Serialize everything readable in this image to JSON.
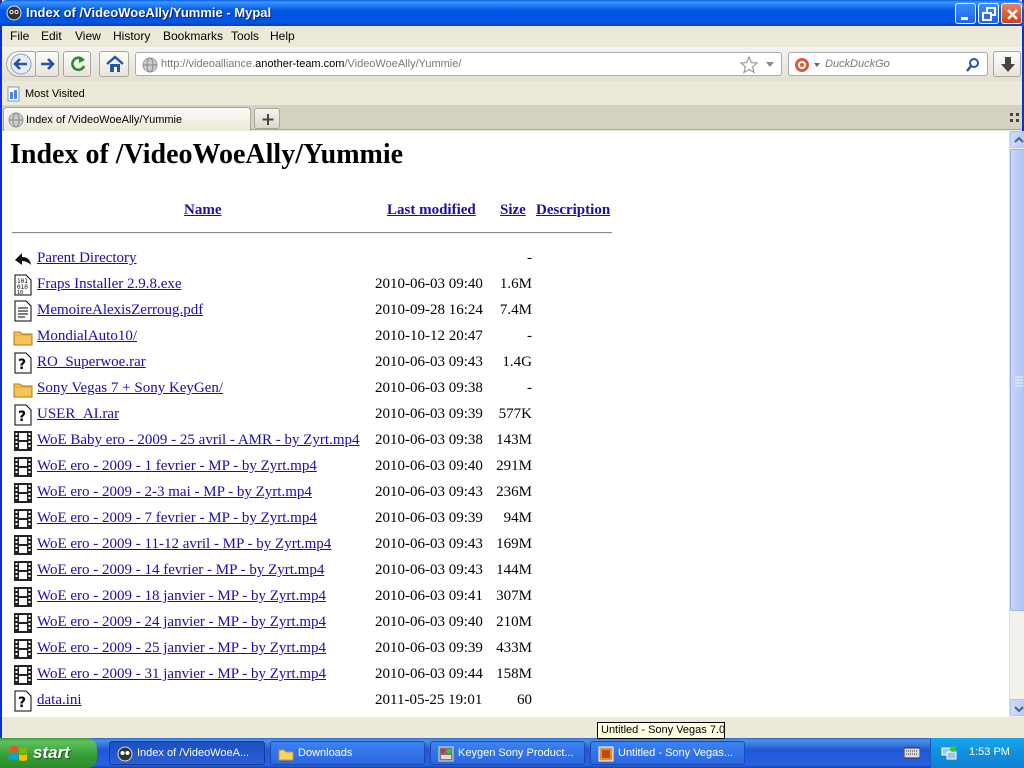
{
  "window": {
    "title": "Index of /VideoWoeAlly/Yummie - Mypal"
  },
  "menu": [
    "File",
    "Edit",
    "View",
    "History",
    "Bookmarks",
    "Tools",
    "Help"
  ],
  "nav": {
    "url_prefix": "http://videoalliance.",
    "url_domain": "another-team.com",
    "url_path": "/VideoWoeAlly/Yummie/",
    "search_placeholder": "DuckDuckGo"
  },
  "bookmarks": {
    "most_visited": "Most Visited"
  },
  "tabs": [
    {
      "label": "Index of /VideoWoeAlly/Yummie"
    }
  ],
  "page": {
    "heading": "Index of /VideoWoeAlly/Yummie",
    "columns": {
      "name": "Name",
      "modified": "Last modified",
      "size": "Size",
      "description": "Description"
    },
    "entries": [
      {
        "icon": "back-icon",
        "name": "Parent Directory",
        "modified": "",
        "size": "-"
      },
      {
        "icon": "binary-icon",
        "name": "Fraps Installer 2.9.8.exe",
        "modified": "2010-06-03 09:40",
        "size": "1.6M"
      },
      {
        "icon": "document-icon",
        "name": "MemoireAlexisZerroug.pdf",
        "modified": "2010-09-28 16:24",
        "size": "7.4M"
      },
      {
        "icon": "folder-icon",
        "name": "MondialAuto10/",
        "modified": "2010-10-12 20:47",
        "size": "-"
      },
      {
        "icon": "unknown-icon",
        "name": "RO_Superwoe.rar",
        "modified": "2010-06-03 09:43",
        "size": "1.4G"
      },
      {
        "icon": "folder-icon",
        "name": "Sony Vegas 7 + Sony KeyGen/",
        "modified": "2010-06-03 09:38",
        "size": "-"
      },
      {
        "icon": "unknown-icon",
        "name": "USER_AI.rar",
        "modified": "2010-06-03 09:39",
        "size": "577K"
      },
      {
        "icon": "movie-icon",
        "name": "WoE Baby ero - 2009 - 25 avril - AMR - by Zyrt.mp4",
        "modified": "2010-06-03 09:38",
        "size": "143M"
      },
      {
        "icon": "movie-icon",
        "name": "WoE ero - 2009 - 1 fevrier - MP - by Zyrt.mp4",
        "modified": "2010-06-03 09:40",
        "size": "291M"
      },
      {
        "icon": "movie-icon",
        "name": "WoE ero - 2009 - 2-3 mai - MP - by Zyrt.mp4",
        "modified": "2010-06-03 09:43",
        "size": "236M"
      },
      {
        "icon": "movie-icon",
        "name": "WoE ero - 2009 - 7 fevrier - MP - by Zyrt.mp4",
        "modified": "2010-06-03 09:39",
        "size": "94M"
      },
      {
        "icon": "movie-icon",
        "name": "WoE ero - 2009 - 11-12 avril - MP - by Zyrt.mp4",
        "modified": "2010-06-03 09:43",
        "size": "169M"
      },
      {
        "icon": "movie-icon",
        "name": "WoE ero - 2009 - 14 fevrier - MP - by Zyrt.mp4",
        "modified": "2010-06-03 09:43",
        "size": "144M"
      },
      {
        "icon": "movie-icon",
        "name": "WoE ero - 2009 - 18 janvier - MP - by Zyrt.mp4",
        "modified": "2010-06-03 09:41",
        "size": "307M"
      },
      {
        "icon": "movie-icon",
        "name": "WoE ero - 2009 - 24 janvier - MP - by Zyrt.mp4",
        "modified": "2010-06-03 09:40",
        "size": "210M"
      },
      {
        "icon": "movie-icon",
        "name": "WoE ero - 2009 - 25 janvier - MP - by Zyrt.mp4",
        "modified": "2010-06-03 09:39",
        "size": "433M"
      },
      {
        "icon": "movie-icon",
        "name": "WoE ero - 2009 - 31 janvier - MP - by Zyrt.mp4",
        "modified": "2010-06-03 09:44",
        "size": "158M"
      },
      {
        "icon": "unknown-icon",
        "name": "data.ini",
        "modified": "2011-05-25 19:01",
        "size": "60"
      }
    ]
  },
  "tooltip": "Untitled - Sony Vegas 7.0",
  "taskbar": {
    "start_label": "start",
    "tasks": [
      {
        "label": "Index of /VideoWoeA...",
        "icon": "browser-icon",
        "active": true
      },
      {
        "label": "Downloads",
        "icon": "folder-icon",
        "active": false
      },
      {
        "label": "Keygen Sony Product...",
        "icon": "keygen-icon",
        "active": false
      },
      {
        "label": "Untitled - Sony Vegas...",
        "icon": "vegas-icon",
        "active": false
      }
    ],
    "clock": "1:53 PM"
  },
  "colors": {
    "link": "#1a0dab",
    "titlebar": "#0054e3",
    "taskbar": "#245edb",
    "start": "#3c9d3c"
  }
}
